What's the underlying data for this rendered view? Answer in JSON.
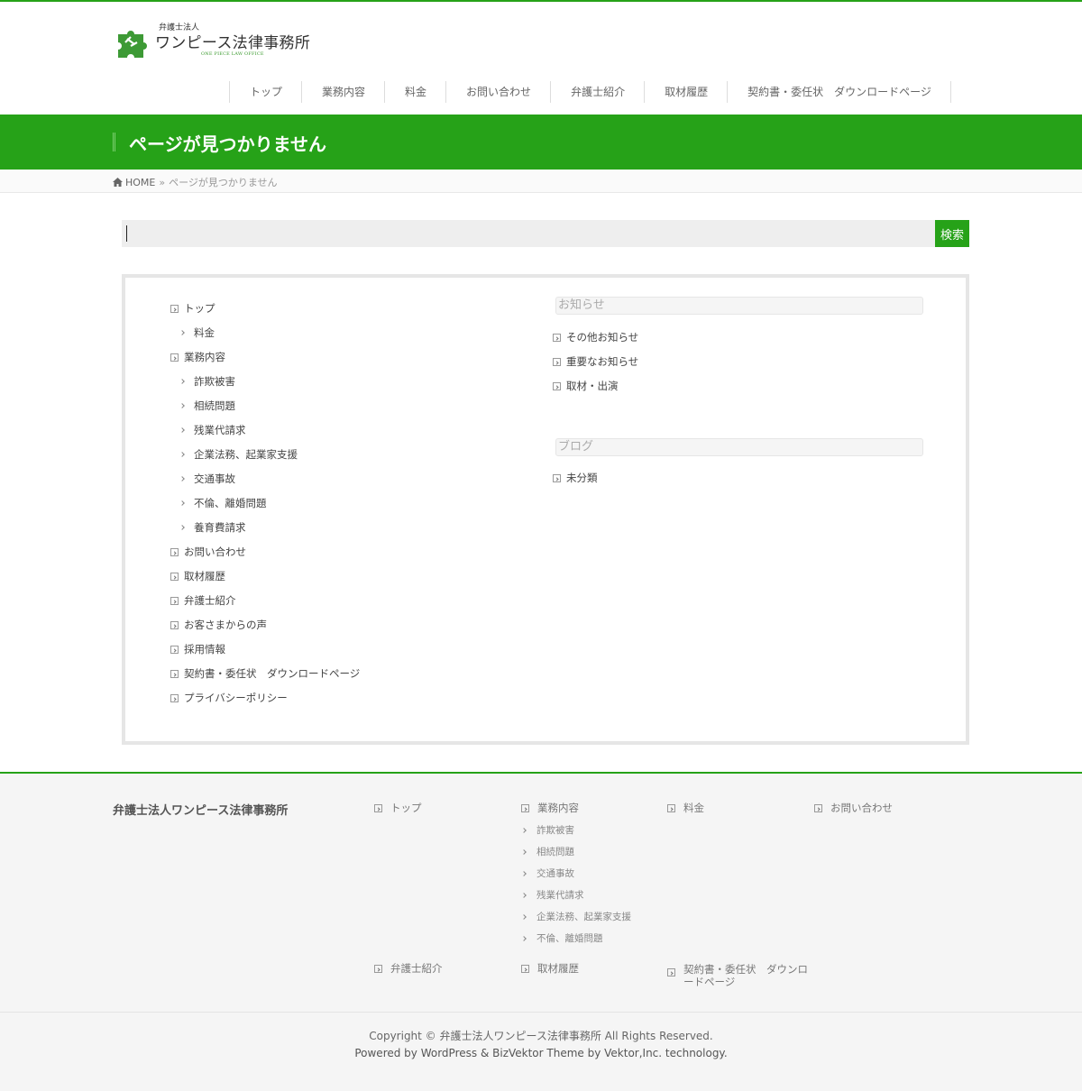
{
  "header": {
    "logo": {
      "sub": "弁護士法人",
      "main": "ワンピース法律事務所",
      "en": "ONE PIECE LAW OFFICE"
    },
    "nav": [
      "トップ",
      "業務内容",
      "料金",
      "お問い合わせ",
      "弁護士紹介",
      "取材履歴",
      "契約書・委任状　ダウンロードページ"
    ]
  },
  "page": {
    "title": "ページが見つかりません"
  },
  "breadcrumb": {
    "home": "HOME",
    "separator": "»",
    "current": "ページが見つかりません"
  },
  "search": {
    "value": "",
    "button": "検索"
  },
  "sitemap": {
    "pages": [
      {
        "label": "トップ",
        "level": 1
      },
      {
        "label": "料金",
        "level": 2
      },
      {
        "label": "業務内容",
        "level": 1
      },
      {
        "label": "詐欺被害",
        "level": 2
      },
      {
        "label": "相続問題",
        "level": 2
      },
      {
        "label": "残業代請求",
        "level": 2
      },
      {
        "label": "企業法務、起業家支援",
        "level": 2
      },
      {
        "label": "交通事故",
        "level": 2
      },
      {
        "label": "不倫、離婚問題",
        "level": 2
      },
      {
        "label": "養育費請求",
        "level": 2
      },
      {
        "label": "お問い合わせ",
        "level": 1
      },
      {
        "label": "取材履歴",
        "level": 1
      },
      {
        "label": "弁護士紹介",
        "level": 1
      },
      {
        "label": "お客さまからの声",
        "level": 1
      },
      {
        "label": "採用情報",
        "level": 1
      },
      {
        "label": "契約書・委任状　ダウンロードページ",
        "level": 1
      },
      {
        "label": "プライバシーポリシー",
        "level": 1
      }
    ],
    "news": {
      "title": "お知らせ",
      "items": [
        "その他お知らせ",
        "重要なお知らせ",
        "取材・出演"
      ]
    },
    "blog": {
      "title": "ブログ",
      "items": [
        "未分類"
      ]
    }
  },
  "footer": {
    "name": "弁護士法人ワンピース法律事務所",
    "col1": [
      "トップ",
      "弁護士紹介"
    ],
    "col2": {
      "main": "業務内容",
      "subs": [
        "詐欺被害",
        "相続問題",
        "交通事故",
        "残業代請求",
        "企業法務、起業家支援",
        "不倫、離婚問題"
      ],
      "after": "取材履歴"
    },
    "col3": [
      "料金",
      "契約書・委任状　ダウンロードページ"
    ],
    "col4": [
      "お問い合わせ"
    ],
    "copyright": "Copyright © 弁護士法人ワンピース法律事務所 All Rights Reserved.",
    "powered": "Powered by WordPress & BizVektor Theme by Vektor,Inc. technology."
  },
  "colors": {
    "accent": "#26a218"
  }
}
